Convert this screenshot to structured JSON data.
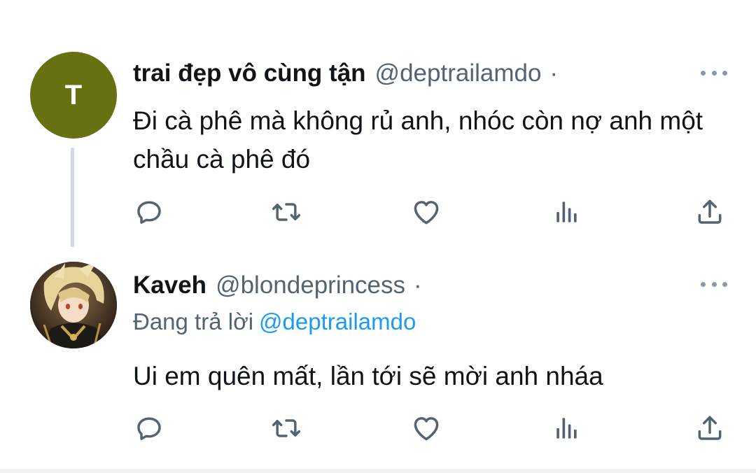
{
  "tweets": [
    {
      "avatar": {
        "letter": "T",
        "color": "#687111"
      },
      "display_name": "trai đẹp vô cùng tận",
      "handle": "@deptrailamdo",
      "separator": "·",
      "text": "Đi cà phê mà không rủ anh, nhóc còn nợ anh một chầu cà phê đó",
      "actions": [
        "reply-icon",
        "retweet-icon",
        "like-icon",
        "views-icon",
        "share-icon"
      ]
    },
    {
      "avatar": {
        "type": "image",
        "description_icon": "anime-character-avatar"
      },
      "display_name": "Kaveh",
      "handle": "@blondeprincess",
      "separator": "·",
      "reply_to": {
        "prefix": "Đang trả lời",
        "mention": "@deptrailamdo"
      },
      "text": "Ui em quên mất, lần tới sẽ mời anh nháa",
      "actions": [
        "reply-icon",
        "retweet-icon",
        "like-icon",
        "views-icon",
        "share-icon"
      ]
    }
  ],
  "colors": {
    "text": "#0f1419",
    "secondary": "#536471",
    "mention": "#1d9bf0",
    "icon": "#536471"
  }
}
